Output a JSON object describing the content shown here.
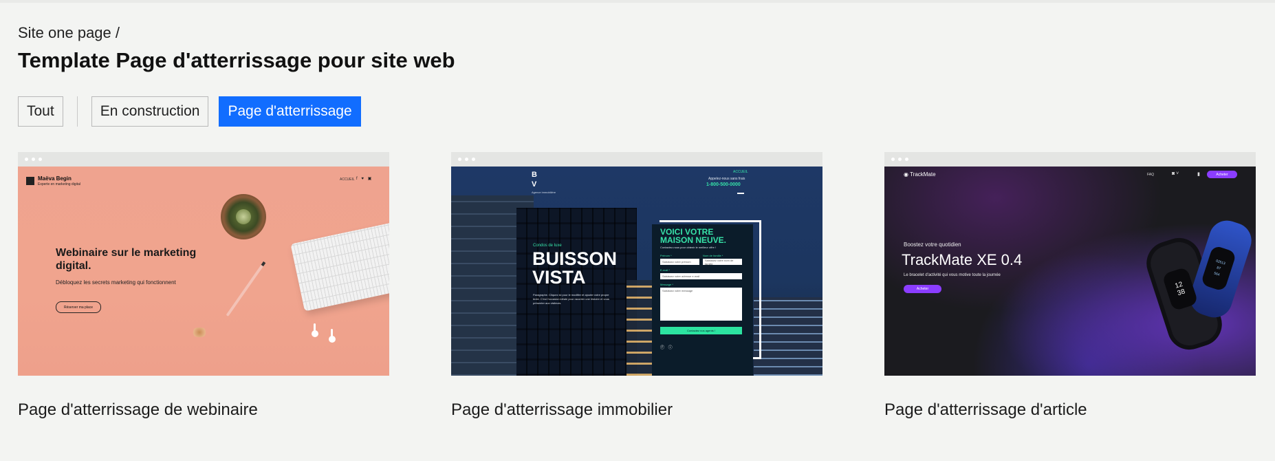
{
  "breadcrumb": "Site one page /",
  "title": "Template Page d'atterrissage pour site web",
  "filters": [
    {
      "label": "Tout",
      "active": false
    },
    {
      "label": "En construction",
      "active": false
    },
    {
      "label": "Page d'atterrissage",
      "active": true
    }
  ],
  "templates": [
    {
      "title": "Page d'atterrissage de webinaire",
      "preview": {
        "brand": "Maëva Begin",
        "brand_sub": "Experte en marketing digital",
        "nav": "ACCUEIL",
        "headline": "Webinaire sur le marketing digital.",
        "subtext": "Débloquez les secrets marketing qui fonctionnent",
        "button": "Réserver ma place"
      }
    },
    {
      "title": "Page d'atterrissage immobilier",
      "preview": {
        "logo": "B\nV",
        "logo_sub": "Agence immobilière",
        "nav": "ACCUEIL",
        "call_label": "Appelez-nous sans frais",
        "phone": "1-800-500-0000",
        "kicker": "Condos de luxe",
        "hero": "BUISSON\nVISTA",
        "blurb": "Paragraphe. Cliquez ici pour le modifier et ajouter votre propre texte. C'est l'occasion idéale pour raconter une histoire et vous présenter aux visiteurs.",
        "form_title": "VOICI VOTRE\nMAISON NEUVE.",
        "form_subtitle": "Contactez-nous pour obtenir le meilleur offre !",
        "first_name_label": "Prénom *",
        "first_name_placeholder": "Saisissez votre prénom",
        "last_name_label": "Nom de famille *",
        "last_name_placeholder": "Saisissez votre nom de famille",
        "email_label": "E-mail *",
        "email_placeholder": "Saisissez votre adresse e-mail",
        "message_label": "Message *",
        "message_placeholder": "Saisissez votre message",
        "submit": "Contactez nos agents !"
      }
    },
    {
      "title": "Page d'atterrissage d'article",
      "preview": {
        "logo": "TrackMate",
        "nav_faq": "FAQ",
        "buy": "Acheter",
        "kicker": "Boostez votre quotidien",
        "headline": "TrackMate XE 0.4",
        "desc": "Le bracelet d'activité qui vous motive toute la journée",
        "cta": "Acheter",
        "screen_time": "12\n38",
        "screen_stats": "02513\n87\n564"
      }
    }
  ],
  "colors": {
    "background": "#f3f4f2",
    "active_filter": "#116dff",
    "estate_accent": "#37e3a8",
    "track_accent": "#8b3dff"
  }
}
